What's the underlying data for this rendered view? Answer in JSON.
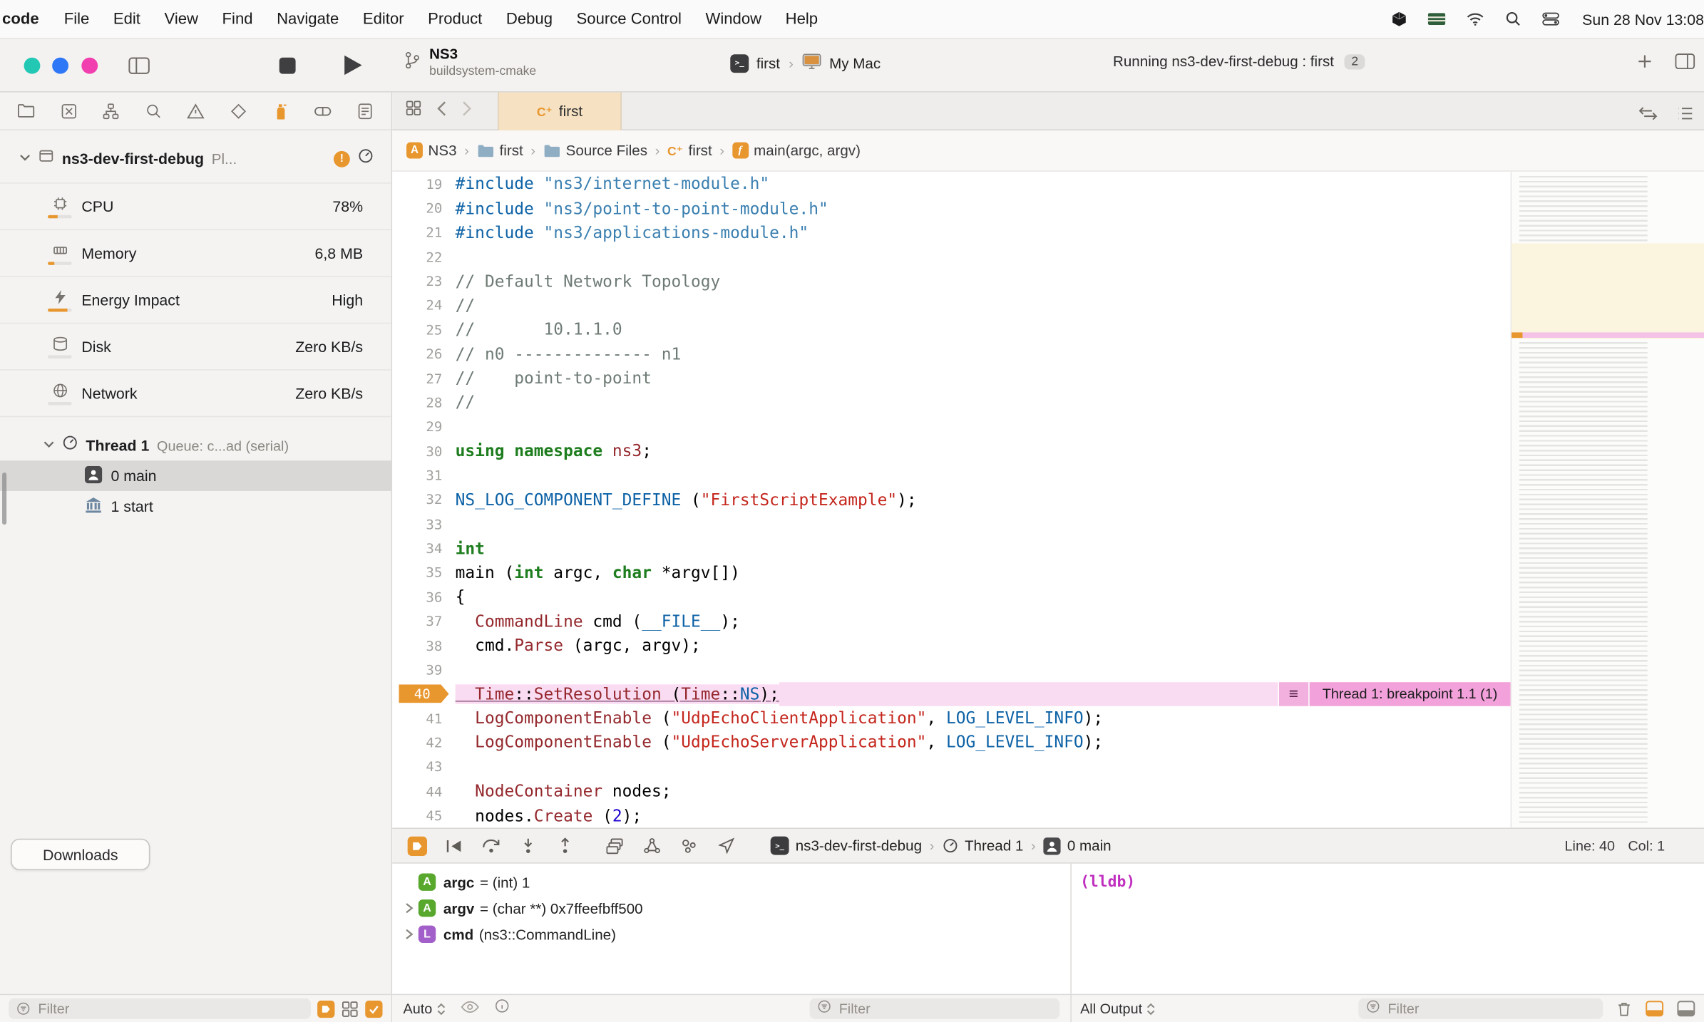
{
  "menu_bar": {
    "app": "code",
    "items": [
      "File",
      "Edit",
      "View",
      "Find",
      "Navigate",
      "Editor",
      "Product",
      "Debug",
      "Source Control",
      "Window",
      "Help"
    ],
    "clock": "Sun 28 Nov 13:08"
  },
  "toolbar": {
    "project": "NS3",
    "build_system": "buildsystem-cmake",
    "scheme": "first",
    "run_destination": "My Mac",
    "activity": "Running ns3-dev-first-debug : first",
    "badge": "2"
  },
  "navigator": {
    "process": {
      "name": "ns3-dev-first-debug",
      "truncated": "Pl..."
    },
    "gauges": [
      {
        "label": "CPU",
        "value": "78%",
        "bar": 0.4
      },
      {
        "label": "Memory",
        "value": "6,8 MB",
        "bar": 0.25
      },
      {
        "label": "Energy Impact",
        "value": "High",
        "bar": 0.8
      },
      {
        "label": "Disk",
        "value": "Zero KB/s",
        "bar": 0
      },
      {
        "label": "Network",
        "value": "Zero KB/s",
        "bar": 0
      }
    ],
    "thread": {
      "name": "Thread 1",
      "detail": "Queue: c...ad (serial)"
    },
    "frames": [
      {
        "label": "0 main",
        "icon": "person",
        "selected": true
      },
      {
        "label": "1 start",
        "icon": "bank",
        "selected": false
      }
    ],
    "downloads": "Downloads",
    "filter_placeholder": "Filter"
  },
  "editor": {
    "tab": "first",
    "breadcrumbs": [
      {
        "label": "NS3",
        "icon": "target"
      },
      {
        "label": "first",
        "icon": "folder"
      },
      {
        "label": "Source Files",
        "icon": "folder"
      },
      {
        "label": "first",
        "icon": "cpp-file"
      },
      {
        "label": "main(argc, argv)",
        "icon": "function"
      }
    ],
    "breakpoint": {
      "line": 40,
      "annotation": "Thread 1: breakpoint 1.1 (1)"
    },
    "code": {
      "lines": [
        {
          "n": 19,
          "t": [
            [
              "#include ",
              "pre"
            ],
            [
              "\"ns3/internet-module.h\"",
              "prestr"
            ]
          ]
        },
        {
          "n": 20,
          "t": [
            [
              "#include ",
              "pre"
            ],
            [
              "\"ns3/point-to-point-module.h\"",
              "prestr"
            ]
          ]
        },
        {
          "n": 21,
          "t": [
            [
              "#include ",
              "pre"
            ],
            [
              "\"ns3/applications-module.h\"",
              "prestr"
            ]
          ]
        },
        {
          "n": 22,
          "t": []
        },
        {
          "n": 23,
          "t": [
            [
              "// Default Network Topology",
              "com"
            ]
          ]
        },
        {
          "n": 24,
          "t": [
            [
              "//",
              "com"
            ]
          ]
        },
        {
          "n": 25,
          "t": [
            [
              "//       10.1.1.0",
              "com"
            ]
          ]
        },
        {
          "n": 26,
          "t": [
            [
              "// n0 -------------- n1",
              "com"
            ]
          ]
        },
        {
          "n": 27,
          "t": [
            [
              "//    point-to-point",
              "com"
            ]
          ]
        },
        {
          "n": 28,
          "t": [
            [
              "//",
              "com"
            ]
          ]
        },
        {
          "n": 29,
          "t": []
        },
        {
          "n": 30,
          "t": [
            [
              "using",
              "kw"
            ],
            [
              " ",
              "p"
            ],
            [
              "namespace",
              "kw"
            ],
            [
              " ",
              "p"
            ],
            [
              "ns3",
              "type"
            ],
            [
              ";",
              "p"
            ]
          ]
        },
        {
          "n": 31,
          "t": []
        },
        {
          "n": 32,
          "t": [
            [
              "NS_LOG_COMPONENT_DEFINE",
              "mac"
            ],
            [
              " (",
              "p"
            ],
            [
              "\"FirstScriptExample\"",
              "str"
            ],
            [
              ");",
              "p"
            ]
          ]
        },
        {
          "n": 33,
          "t": []
        },
        {
          "n": 34,
          "t": [
            [
              "int",
              "kw"
            ]
          ]
        },
        {
          "n": 35,
          "t": [
            [
              "main (",
              "p"
            ],
            [
              "int",
              "kw"
            ],
            [
              " argc, ",
              "p"
            ],
            [
              "char",
              "kw"
            ],
            [
              " *argv[])",
              "p"
            ]
          ]
        },
        {
          "n": 36,
          "t": [
            [
              "{",
              "p"
            ]
          ]
        },
        {
          "n": 37,
          "t": [
            [
              "  ",
              "p"
            ],
            [
              "CommandLine",
              "type"
            ],
            [
              " cmd (",
              "p"
            ],
            [
              "__FILE__",
              "mac"
            ],
            [
              ");",
              "p"
            ]
          ]
        },
        {
          "n": 38,
          "t": [
            [
              "  cmd.",
              "p"
            ],
            [
              "Parse",
              "fn"
            ],
            [
              " (argc, argv);",
              "p"
            ]
          ]
        },
        {
          "n": 39,
          "t": []
        },
        {
          "n": 40,
          "t": [
            [
              "  ",
              "p"
            ],
            [
              "Time",
              "type"
            ],
            [
              "::",
              "p"
            ],
            [
              "SetResolution",
              "fn"
            ],
            [
              " (",
              "p"
            ],
            [
              "Time",
              "type"
            ],
            [
              "::",
              "p"
            ],
            [
              "NS",
              "mac"
            ],
            [
              ");",
              "p"
            ]
          ]
        },
        {
          "n": 41,
          "t": [
            [
              "  ",
              "p"
            ],
            [
              "LogComponentEnable",
              "fn"
            ],
            [
              " (",
              "p"
            ],
            [
              "\"UdpEchoClientApplication\"",
              "str"
            ],
            [
              ", ",
              "p"
            ],
            [
              "LOG_LEVEL_INFO",
              "mac"
            ],
            [
              ");",
              "p"
            ]
          ]
        },
        {
          "n": 42,
          "t": [
            [
              "  ",
              "p"
            ],
            [
              "LogComponentEnable",
              "fn"
            ],
            [
              " (",
              "p"
            ],
            [
              "\"UdpEchoServerApplication\"",
              "str"
            ],
            [
              ", ",
              "p"
            ],
            [
              "LOG_LEVEL_INFO",
              "mac"
            ],
            [
              ");",
              "p"
            ]
          ]
        },
        {
          "n": 43,
          "t": []
        },
        {
          "n": 44,
          "t": [
            [
              "  ",
              "p"
            ],
            [
              "NodeContainer",
              "type"
            ],
            [
              " nodes;",
              "p"
            ]
          ]
        },
        {
          "n": 45,
          "t": [
            [
              "  nodes.",
              "p"
            ],
            [
              "Create",
              "fn"
            ],
            [
              " (",
              "p"
            ],
            [
              "2",
              "num"
            ],
            [
              ");",
              "p"
            ]
          ]
        }
      ]
    }
  },
  "debug_bar": {
    "crumbs": [
      {
        "label": "ns3-dev-first-debug",
        "icon": "executable"
      },
      {
        "label": "Thread 1",
        "icon": "gauge"
      },
      {
        "label": "0 main",
        "icon": "person"
      }
    ],
    "line": "Line: 40",
    "col": "Col: 1"
  },
  "debug_area": {
    "variables": [
      {
        "badge": "A",
        "color": "#59a82e",
        "name": "argc",
        "desc": "= (int) 1",
        "expandable": false
      },
      {
        "badge": "A",
        "color": "#59a82e",
        "name": "argv",
        "desc": "= (char **) 0x7ffeefbff500",
        "expandable": true
      },
      {
        "badge": "L",
        "color": "#a35fc9",
        "name": "cmd",
        "desc": "(ns3::CommandLine)",
        "expandable": true
      }
    ],
    "console_text": "(lldb)",
    "scope_popup": "Auto",
    "vars_filter_placeholder": "Filter",
    "output_popup": "All Output",
    "console_filter_placeholder": "Filter"
  },
  "icons": {
    "terminal_glyph": ">_",
    "issue_glyph": "!",
    "bp_menu_glyph": "≡",
    "chevron": "›",
    "cpp_badge": "C⁺",
    "function_badge": "f",
    "target_badge": "A"
  },
  "colors": {
    "accent_orange": "#e8962e",
    "breakpoint_pink": "#f2a1da",
    "traffic_lights": [
      "#23c8b4",
      "#2e77f6",
      "#f23fb0"
    ]
  }
}
